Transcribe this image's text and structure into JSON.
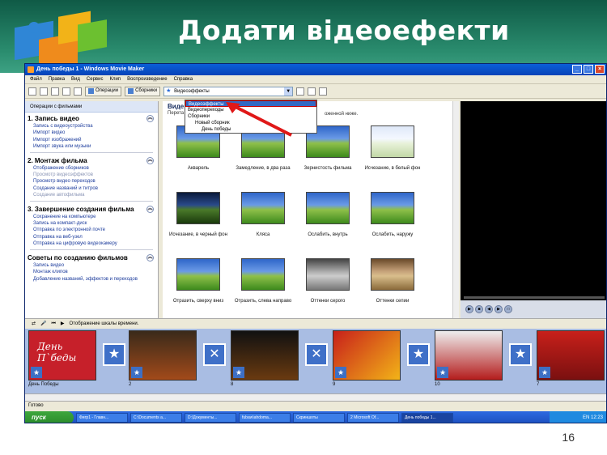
{
  "slide": {
    "title": "Додати відеоефекти",
    "page_number": "16"
  },
  "window": {
    "title": "День победы 1 - Windows Movie Maker",
    "menu": [
      "Файл",
      "Правка",
      "Вид",
      "Сервис",
      "Клип",
      "Воспроизведение",
      "Справка"
    ],
    "toolbar": {
      "operations_label": "Операции",
      "collections_label": "Сборники",
      "combo_value": "Видеоэффекты"
    },
    "dropdown": [
      "Видеоэффекты",
      "Видеопереходы",
      "Сборники",
      "Новый сборник",
      "День победы"
    ]
  },
  "taskpane": {
    "header": "Операции с фильмами",
    "sections": [
      {
        "title": "1. Запись видео",
        "links": [
          "Запись с видеоустройства",
          "Импорт видео",
          "Импорт изображений",
          "Импорт звука или музыки"
        ]
      },
      {
        "title": "2. Монтаж фильма",
        "links": [
          "Отображение сборников",
          "Просмотр видеоэффектов",
          "Просмотр видео переходов",
          "Создание названий и титров",
          "Создание автофильма"
        ]
      },
      {
        "title": "3. Завершение создания фильма",
        "links": [
          "Сохранение на компьютере",
          "Запись на компакт-диск",
          "Отправка по электронной почте",
          "Отправка на веб-узел",
          "Отправка на цифровую видеокамеру"
        ]
      },
      {
        "title": "Советы по созданию фильмов",
        "links": [
          "Запись видео",
          "Монтаж клипов",
          "Добавление названий, эффектов и переходов"
        ]
      }
    ]
  },
  "collection": {
    "title": "Виде",
    "subtitle_left": "Перета",
    "subtitle_right": "оженной ниже.",
    "effects": [
      "Акварель",
      "Замедление, в два раза",
      "Зернистость фильма",
      "Исчезание, в белый фон",
      "Исчезание, в черный фон",
      "Кляса",
      "Ослабить, внутрь",
      "Ослабить, наружу",
      "Отразить, сверху вниз",
      "Отразить, слева направо",
      "Оттенки серого",
      "Оттенки сепии"
    ]
  },
  "storyboard": {
    "toolbar_label": "Отображение шкалы времени.",
    "clips": [
      {
        "label": "День Победы",
        "caption": "День П`беды"
      },
      {
        "label": "2"
      },
      {
        "label": "8"
      },
      {
        "label": "9"
      },
      {
        "label": "10"
      },
      {
        "label": "7"
      }
    ]
  },
  "status": "Готово",
  "taskbar": {
    "start": "пуск",
    "tasks": [
      "Фигр1 - Главн...",
      "C:\\Documents a...",
      "D:\\Документы...",
      "fubaw\\ahdoma...",
      "Скриншоты",
      "2 Microsoft Of...",
      "День победы 1..."
    ],
    "lang": "EN",
    "clock": "12:23"
  }
}
